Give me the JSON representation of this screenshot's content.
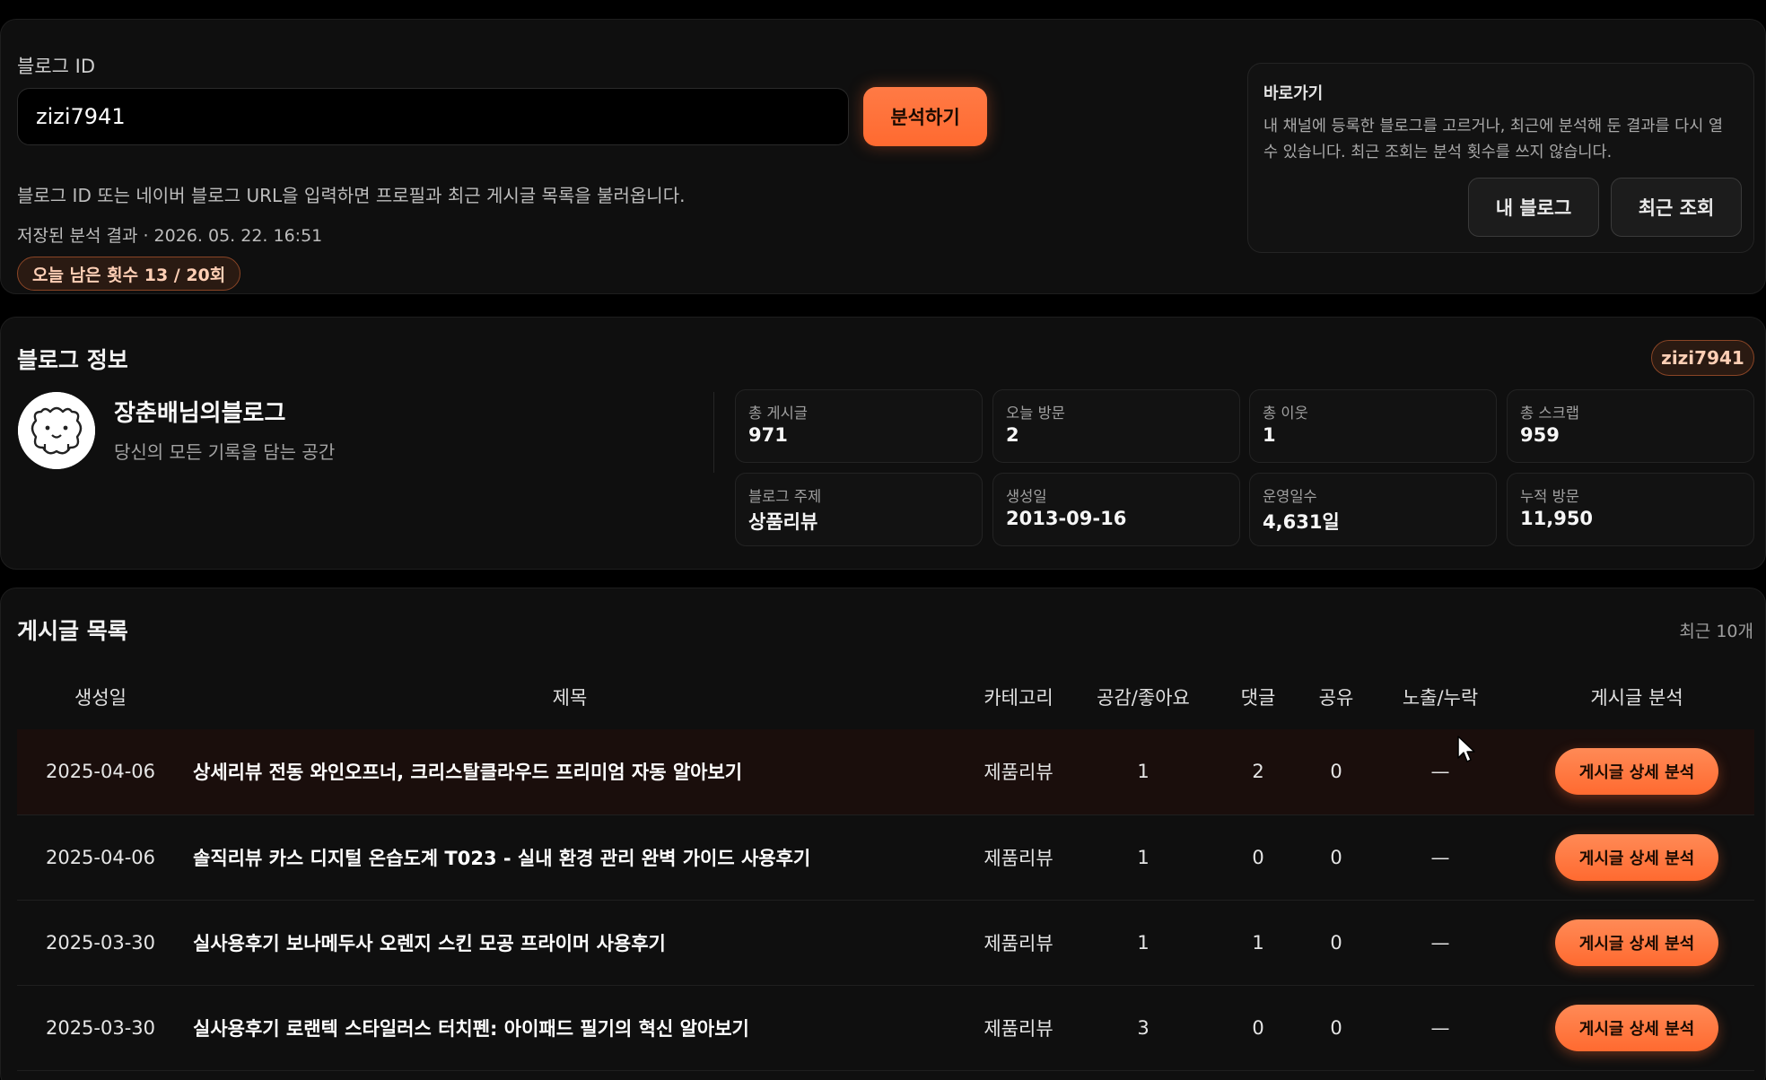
{
  "search": {
    "label": "블로그 ID",
    "value": "zizi7941",
    "analyze_label": "분석하기",
    "hint": "블로그 ID 또는 네이버 블로그 URL을 입력하면 프로필과 최근 게시글 목록을 불러옵니다.",
    "saved_result": "저장된 분석 결과 · 2026. 05. 22. 16:51",
    "quota": "오늘 남은 횟수 13 / 20회"
  },
  "quick": {
    "title": "바로가기",
    "desc": "내 채널에 등록한 블로그를 고르거나, 최근에 분석해 둔 결과를 다시 열 수 있습니다. 최근 조회는 분석 횟수를 쓰지 않습니다.",
    "my_blog_label": "내 블로그",
    "recent_label": "최근 조회"
  },
  "info": {
    "title": "블로그 정보",
    "id_badge": "zizi7941",
    "blog_name": "장춘배님의블로그",
    "blog_desc": "당신의 모든 기록을 담는 공간",
    "stats": [
      {
        "label": "총 게시글",
        "value": "971"
      },
      {
        "label": "오늘 방문",
        "value": "2"
      },
      {
        "label": "총 이웃",
        "value": "1"
      },
      {
        "label": "총 스크랩",
        "value": "959"
      },
      {
        "label": "블로그 주제",
        "value": "상품리뷰"
      },
      {
        "label": "생성일",
        "value": "2013-09-16"
      },
      {
        "label": "운영일수",
        "value": "4,631일"
      },
      {
        "label": "누적 방문",
        "value": "11,950"
      }
    ]
  },
  "posts": {
    "title": "게시글 목록",
    "recent_count": "최근 10개",
    "headers": {
      "date": "생성일",
      "title": "제목",
      "category": "카테고리",
      "likes": "공감/좋아요",
      "comments": "댓글",
      "shares": "공유",
      "exposure": "노출/누락",
      "analysis": "게시글 분석"
    },
    "detail_label": "게시글 상세 분석",
    "rows": [
      {
        "date": "2025-04-06",
        "title": "상세리뷰 전동 와인오프너, 크리스탈클라우드 프리미엄 자동 알아보기",
        "category": "제품리뷰",
        "likes": "1",
        "comments": "2",
        "shares": "0",
        "exposure": "—"
      },
      {
        "date": "2025-04-06",
        "title": "솔직리뷰 카스 디지털 온습도계 T023 - 실내 환경 관리 완벽 가이드 사용후기",
        "category": "제품리뷰",
        "likes": "1",
        "comments": "0",
        "shares": "0",
        "exposure": "—"
      },
      {
        "date": "2025-03-30",
        "title": "실사용후기 보나메두사 오렌지 스킨 모공 프라이머 사용후기",
        "category": "제품리뷰",
        "likes": "1",
        "comments": "1",
        "shares": "0",
        "exposure": "—"
      },
      {
        "date": "2025-03-30",
        "title": "실사용후기 로랜텍 스타일러스 터치펜: 아이패드 필기의 혁신 알아보기",
        "category": "제품리뷰",
        "likes": "3",
        "comments": "0",
        "shares": "0",
        "exposure": "—"
      }
    ]
  }
}
